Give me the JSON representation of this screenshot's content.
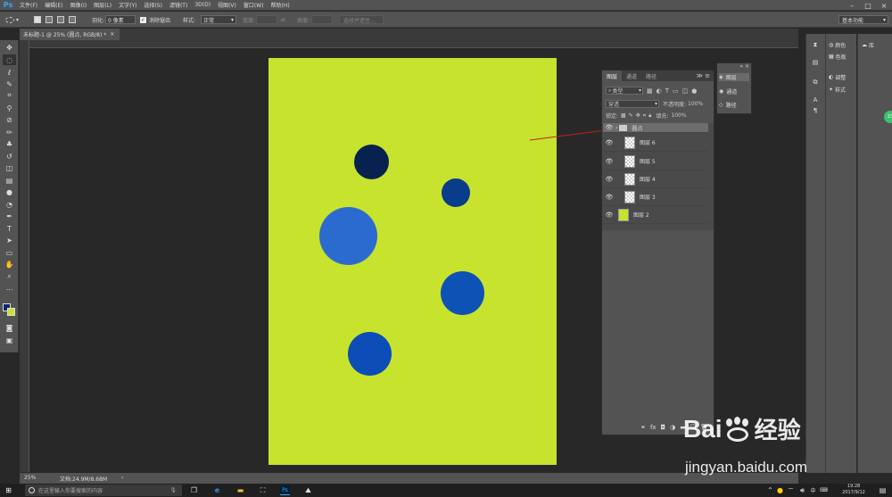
{
  "app": {
    "logo": "Ps"
  },
  "menubar": {
    "items": [
      "文件(F)",
      "编辑(E)",
      "图像(I)",
      "图层(L)",
      "文字(Y)",
      "选择(S)",
      "滤镜(T)",
      "3D(D)",
      "视图(V)",
      "窗口(W)",
      "帮助(H)"
    ]
  },
  "options": {
    "feather_label": "羽化:",
    "feather_value": "0 像素",
    "antialias_label": "消除锯齿",
    "style_label": "样式:",
    "style_value": "正常",
    "width_label": "宽度:",
    "height_label": "高度:",
    "select_mask_label": "选择并遮住...",
    "workspace": "基本功能"
  },
  "document": {
    "tab_title": "未标题-1 @ 25% (圆点, RGB/8) *"
  },
  "status": {
    "zoom": "25%",
    "doc_info": "文档:24.9M/8.68M"
  },
  "layers_panel": {
    "tabs": [
      "图层",
      "通道",
      "路径"
    ],
    "filter_label": "类型",
    "blend_mode": "穿透",
    "opacity_label": "不透明度:",
    "opacity_value": "100%",
    "lock_label": "锁定:",
    "fill_label": "填充:",
    "fill_value": "100%",
    "layers": [
      {
        "name": "圆点",
        "type": "group",
        "selected": true
      },
      {
        "name": "图层 6",
        "type": "transparent"
      },
      {
        "name": "图层 5",
        "type": "transparent"
      },
      {
        "name": "图层 4",
        "type": "transparent"
      },
      {
        "name": "图层 3",
        "type": "transparent"
      },
      {
        "name": "图层 2",
        "type": "fill",
        "color": "#c7e32e"
      }
    ]
  },
  "mini_panel": {
    "items": [
      "图层",
      "通道",
      "路径"
    ]
  },
  "dock": {
    "color": "颜色",
    "swatches": "色板",
    "adjust": "调整",
    "styles": "样式",
    "library": "库"
  },
  "taskbar": {
    "search_placeholder": "在这里输入你要搜索的内容",
    "ime": "中",
    "time": "19:28",
    "date": "2017/9/12"
  },
  "watermark": {
    "brand": "Bai",
    "brand2": "经验",
    "url": "jingyan.baidu.com"
  },
  "colors": {
    "canvas_bg": "#c7e32e",
    "circle_dark": "#08224f",
    "circle_navy": "#0a3c8c",
    "circle_light": "#2b6bcf",
    "circle_mid": "#0d52b5",
    "circle_bottom": "#0d4db8",
    "foreground": "#0a2a6a",
    "background": "#c7e32e"
  }
}
